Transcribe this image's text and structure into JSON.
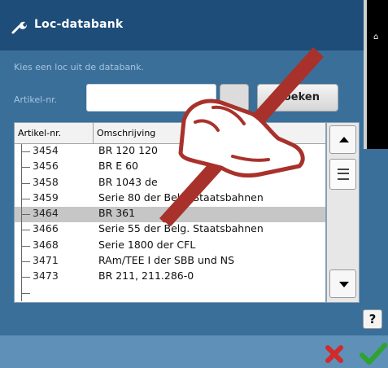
{
  "window": {
    "title": "Loc-databank",
    "title_icon": "wrench-icon"
  },
  "dialog": {
    "prompt": "Kies een loc uit de databank.",
    "article_label": "Artikel-nr.",
    "article_value": "",
    "search_label": "Zoeken"
  },
  "list": {
    "headers": [
      "Artikel-nr.",
      "Omschrijving"
    ],
    "selected_index": 4,
    "rows": [
      {
        "nr": "3454",
        "desc": "BR 120 120"
      },
      {
        "nr": "3456",
        "desc": "BR E 60"
      },
      {
        "nr": "3458",
        "desc": "BR 1043 de"
      },
      {
        "nr": "3459",
        "desc": "Serie 80 der Belg. Staatsbahnen"
      },
      {
        "nr": "3464",
        "desc": "BR 361"
      },
      {
        "nr": "3466",
        "desc": "Serie 55 der Belg. Staatsbahnen"
      },
      {
        "nr": "3468",
        "desc": "Serie 1800 der CFL"
      },
      {
        "nr": "3471",
        "desc": "RAm/TEE I der SBB und NS"
      },
      {
        "nr": "3473",
        "desc": "BR 211, 211.286-0"
      },
      {
        "nr": "",
        "desc": ""
      }
    ]
  },
  "buttons": {
    "help_label": "?",
    "cancel_icon": "close-icon",
    "ok_icon": "check-icon"
  },
  "colors": {
    "title_bar": "#1e4d7a",
    "background": "#3a6f9a",
    "selection": "#c6c6c6",
    "cancel_red": "#d22a2a",
    "ok_green": "#2fa32f",
    "pen_overlay": "#a8322b"
  }
}
